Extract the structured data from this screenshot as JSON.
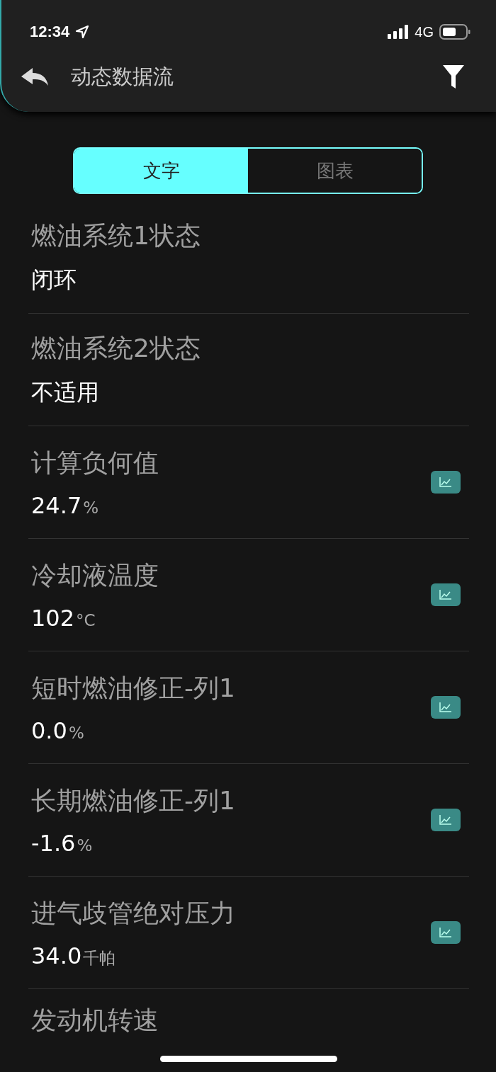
{
  "status_bar": {
    "time": "12:34",
    "network": "4G"
  },
  "header": {
    "title": "动态数据流"
  },
  "tabs": [
    {
      "label": "文字",
      "selected": true
    },
    {
      "label": "图表",
      "selected": false
    }
  ],
  "items": [
    {
      "name": "燃油系统1状态",
      "value": "闭环",
      "chart": false
    },
    {
      "name": "燃油系统2状态",
      "value": "不适用",
      "chart": false
    },
    {
      "name": "计算负何值",
      "value": "24.7",
      "unit": "%",
      "chart": true
    },
    {
      "name": "冷却液温度",
      "value": "102",
      "unit": "°C",
      "chart": true
    },
    {
      "name": "短时燃油修正-列1",
      "value": "0.0",
      "unit": "%",
      "chart": true
    },
    {
      "name": "长期燃油修正-列1",
      "value": "-1.6",
      "unit": "%",
      "chart": true
    },
    {
      "name": "进气歧管绝对压力",
      "value": "34.0",
      "unit": "千帕",
      "chart": true
    },
    {
      "name": "发动机转速",
      "chart": false
    }
  ]
}
